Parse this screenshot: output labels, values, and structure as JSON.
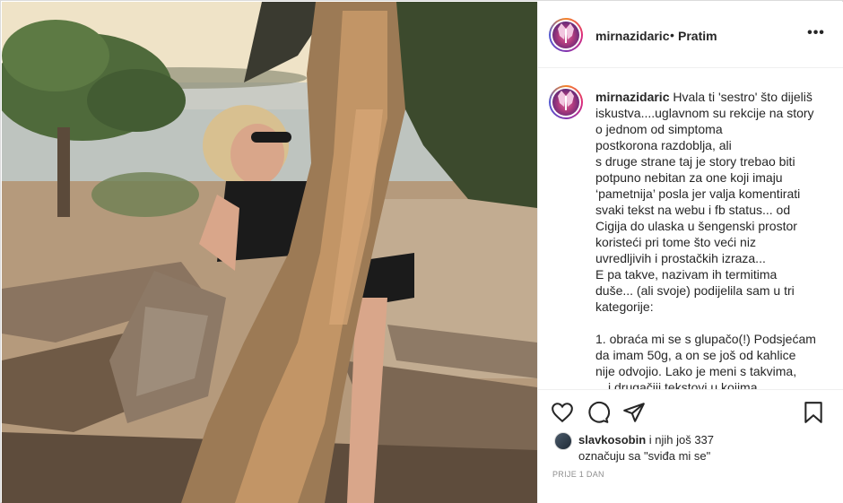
{
  "post": {
    "username": "mirnazidaric",
    "separator": "•",
    "follow_label": "Pratim",
    "more_label": "•••",
    "caption_user": "mirnazidaric",
    "caption_lines": [
      "Hvala ti 'sestro' što dijeliš",
      "iskustva....uglavnom su rekcije na story",
      "o jednom od simptoma",
      "postkorona razdoblja, ali",
      "s druge strane taj je story trebao biti",
      "potpuno nebitan za one koji imaju",
      "‘pametnija’ posla jer valja komentirati",
      "svaki tekst na webu i fb status... od",
      "Cigija do ulaska u šengenski prostor",
      "koristeći pri tome što veći niz",
      "uvredljivih i prostačkih izraza...",
      "E pa takve, nazivam ih termitima",
      "duše... (ali svoje) podijelila sam u tri",
      "kategorije:",
      "",
      "1. obraća mi se s glupačo(!) Podsjećam",
      "da imam 50g, a on se još od kahlice",
      "nije odvojio. Lako je meni s takvima,",
      "…i drugačiji tekstovi u kojima..."
    ],
    "likes_user": "slavkosobin",
    "likes_suffix": " i njih još 337",
    "likes_line2": "označuju sa \"sviđa mi se\"",
    "timestamp": "PRIJE 1 DAN"
  },
  "icons": {
    "like": "heart-icon",
    "comment": "comment-icon",
    "share": "paper-plane-icon",
    "save": "bookmark-icon",
    "more": "ellipsis-icon"
  }
}
